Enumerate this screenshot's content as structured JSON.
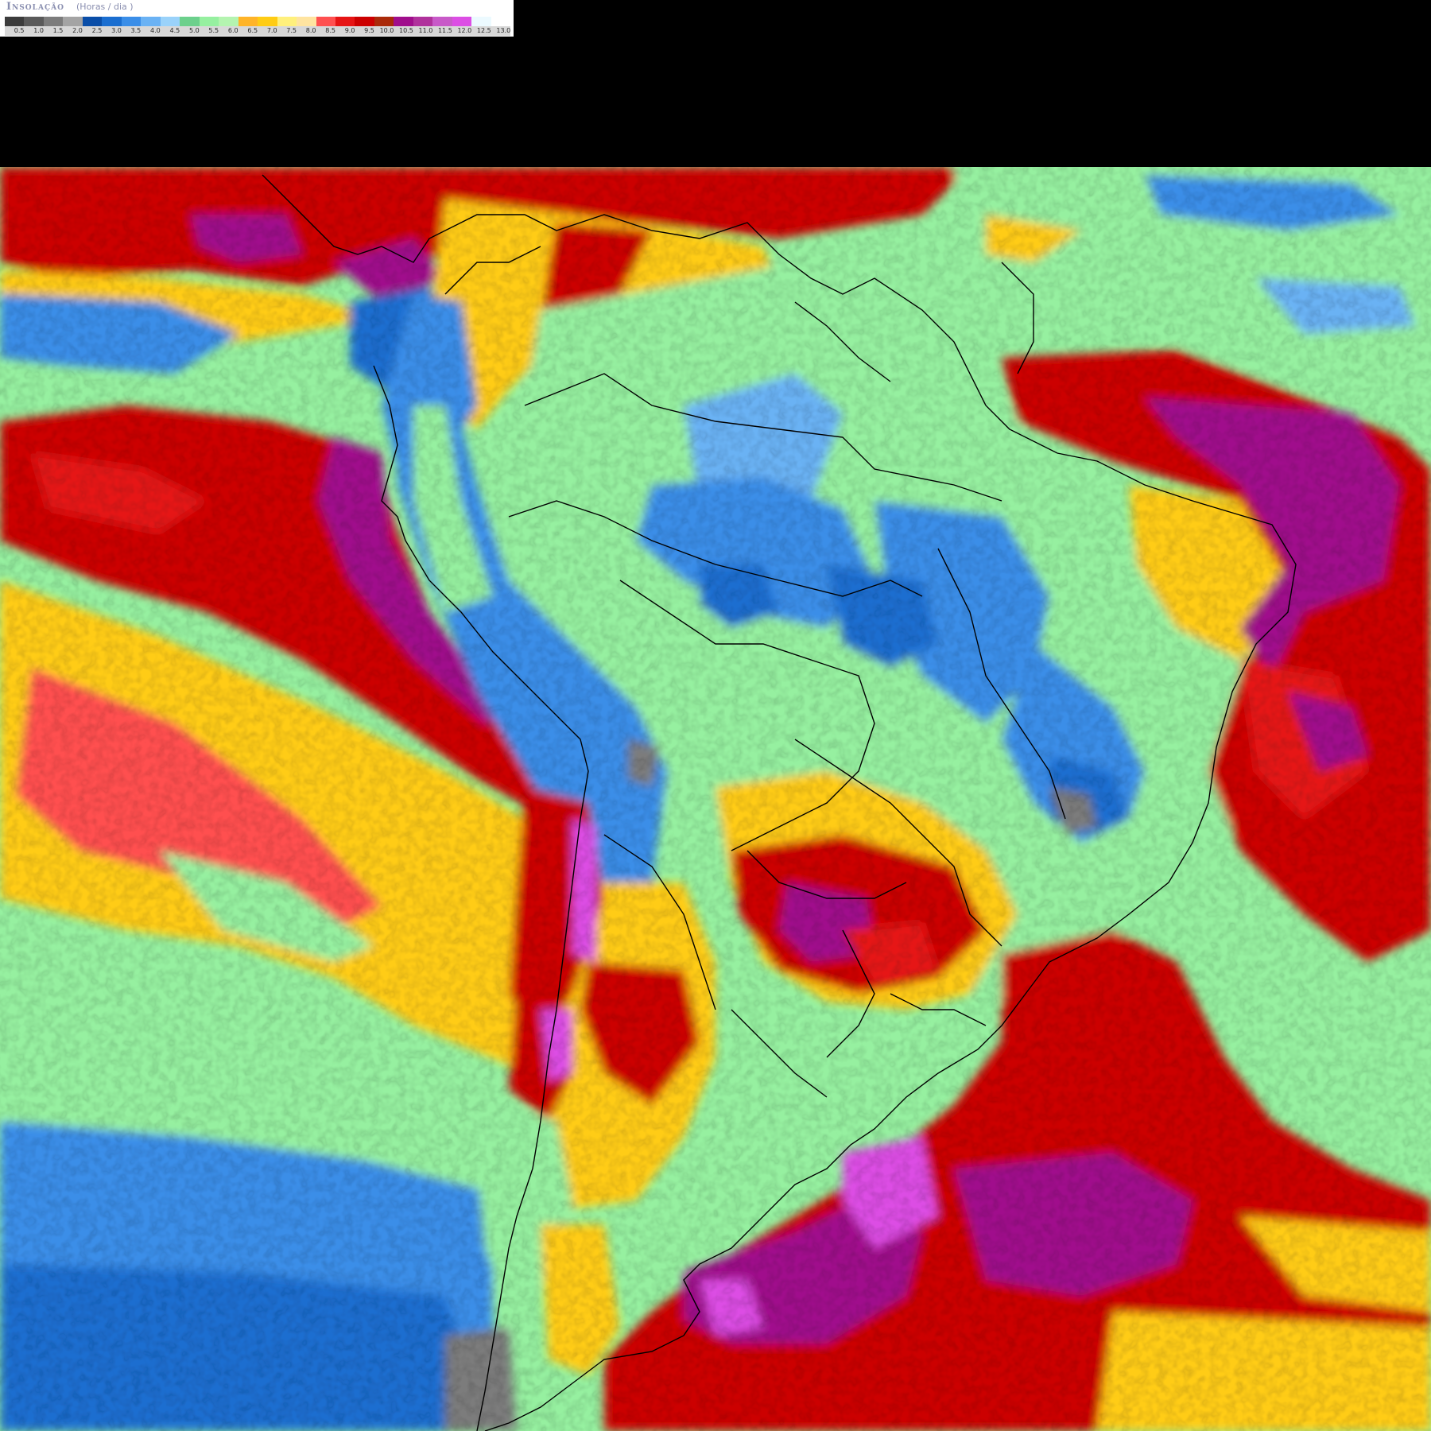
{
  "legend": {
    "title": "Insolação",
    "unit": "(Horas / dia )",
    "colors": [
      "#3c3c3c",
      "#5a5a5a",
      "#7c7c7c",
      "#a4a4a4",
      "#0a4ea8",
      "#1a6ed0",
      "#3a8ee8",
      "#6ab2f4",
      "#9ad2fa",
      "#6cd08c",
      "#96f0a0",
      "#b4f4b0",
      "#ffb428",
      "#ffcc14",
      "#fff07c",
      "#ffe4a0",
      "#ff5050",
      "#e61414",
      "#cc0000",
      "#aa2a0a",
      "#a00e8c",
      "#b0329c",
      "#c85ac8",
      "#dc4ee4",
      "#ecfaff",
      "#ffffff"
    ],
    "ticks": [
      "0.5",
      "1.0",
      "1.5",
      "2.0",
      "2.5",
      "3.0",
      "3.5",
      "4.0",
      "4.5",
      "5.0",
      "5.5",
      "6.0",
      "6.5",
      "7.0",
      "7.5",
      "8.0",
      "8.5",
      "9.0",
      "9.5",
      "10.0",
      "10.5",
      "11.0",
      "11.5",
      "12.0",
      "12.5",
      "13.0"
    ]
  }
}
